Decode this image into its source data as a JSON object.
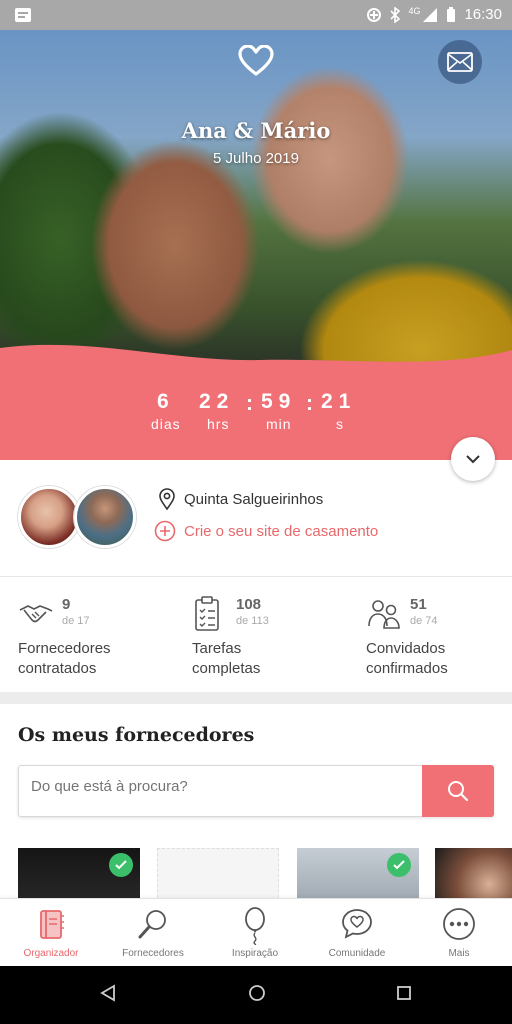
{
  "status_bar": {
    "time": "16:30",
    "network": "4G"
  },
  "hero": {
    "couple_names": "Ana & Mário",
    "wedding_date": "5 Julho 2019",
    "countdown": {
      "days": "6",
      "days_label": "dias",
      "hours": "22",
      "hours_label": "hrs",
      "minutes": "59",
      "minutes_label": "min",
      "seconds": "21",
      "seconds_label": "s",
      "separator": ":"
    }
  },
  "profile": {
    "venue": "Quinta Salgueirinhos",
    "create_site_label": "Crie o seu site de casamento"
  },
  "stats": [
    {
      "value": "9",
      "of": "de 17",
      "label_line1": "Fornecedores",
      "label_line2": "contratados",
      "icon": "handshake-icon"
    },
    {
      "value": "108",
      "of": "de 113",
      "label_line1": "Tarefas",
      "label_line2": "completas",
      "icon": "checklist-icon"
    },
    {
      "value": "51",
      "of": "de 74",
      "label_line1": "Convidados",
      "label_line2": "confirmados",
      "icon": "guests-icon"
    }
  ],
  "vendors": {
    "title": "Os meus fornecedores",
    "search_placeholder": "Do que está à procura?"
  },
  "tabbar": {
    "items": [
      {
        "label": "Organizador",
        "icon": "organizer-icon",
        "active": true
      },
      {
        "label": "Fornecedores",
        "icon": "search-vendors-icon",
        "active": false
      },
      {
        "label": "Inspiração",
        "icon": "balloon-icon",
        "active": false
      },
      {
        "label": "Comunidade",
        "icon": "community-icon",
        "active": false
      },
      {
        "label": "Mais",
        "icon": "more-icon",
        "active": false
      }
    ]
  },
  "colors": {
    "accent": "#f07075",
    "accent_text": "#e8686b",
    "check": "#3cbf6b"
  }
}
